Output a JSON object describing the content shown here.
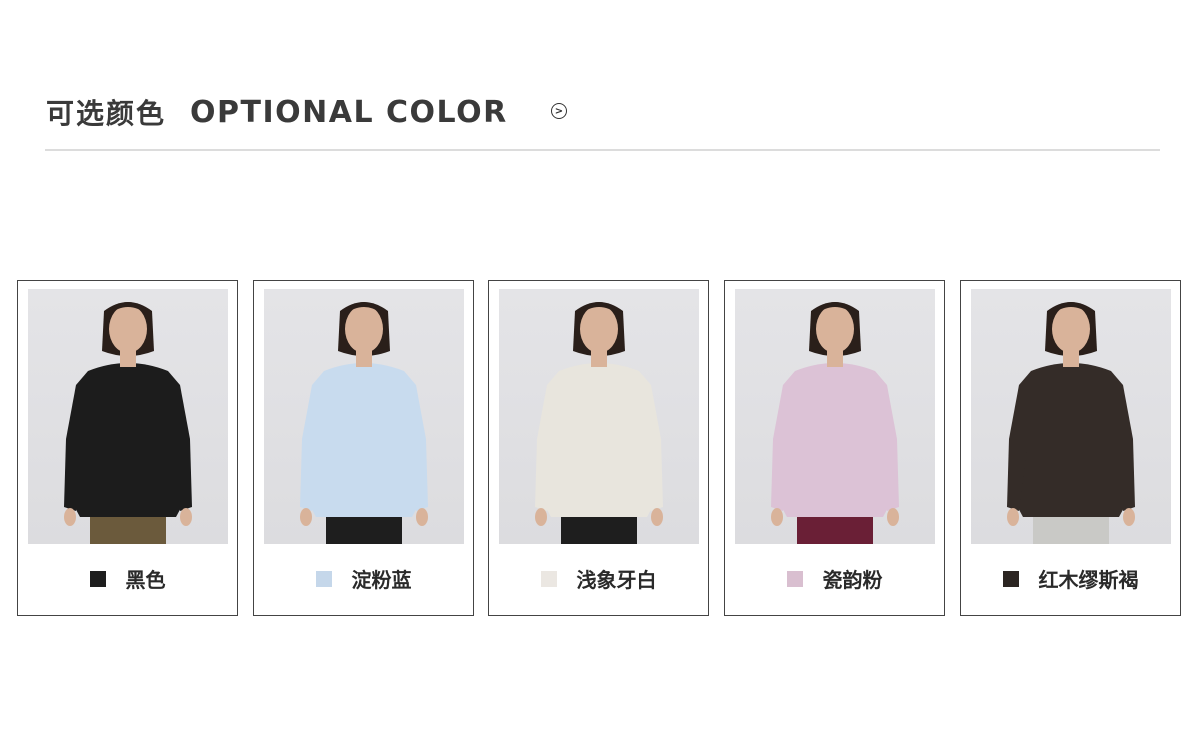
{
  "header": {
    "title_cn": "可选颜色",
    "title_en": "OPTIONAL COLOR",
    "arrow_icon": "circle-chevron-right-icon"
  },
  "colors": [
    {
      "label": "黑色",
      "swatch": "#1e1e1e",
      "shirt": "#1c1c1c",
      "pants": "#6b5a3c"
    },
    {
      "label": "淀粉蓝",
      "swatch": "#c5d7ea",
      "shirt": "#c8dbee",
      "pants": "#1e1e1e"
    },
    {
      "label": "浅象牙白",
      "swatch": "#ebe7e2",
      "shirt": "#e8e5dd",
      "pants": "#1e1e1e"
    },
    {
      "label": "瓷韵粉",
      "swatch": "#d9bfd0",
      "shirt": "#dcc2d6",
      "pants": "#6a1f36"
    },
    {
      "label": "红木缪斯褐",
      "swatch": "#2c2522",
      "shirt": "#342c28",
      "pants": "#c9c9c6"
    }
  ]
}
